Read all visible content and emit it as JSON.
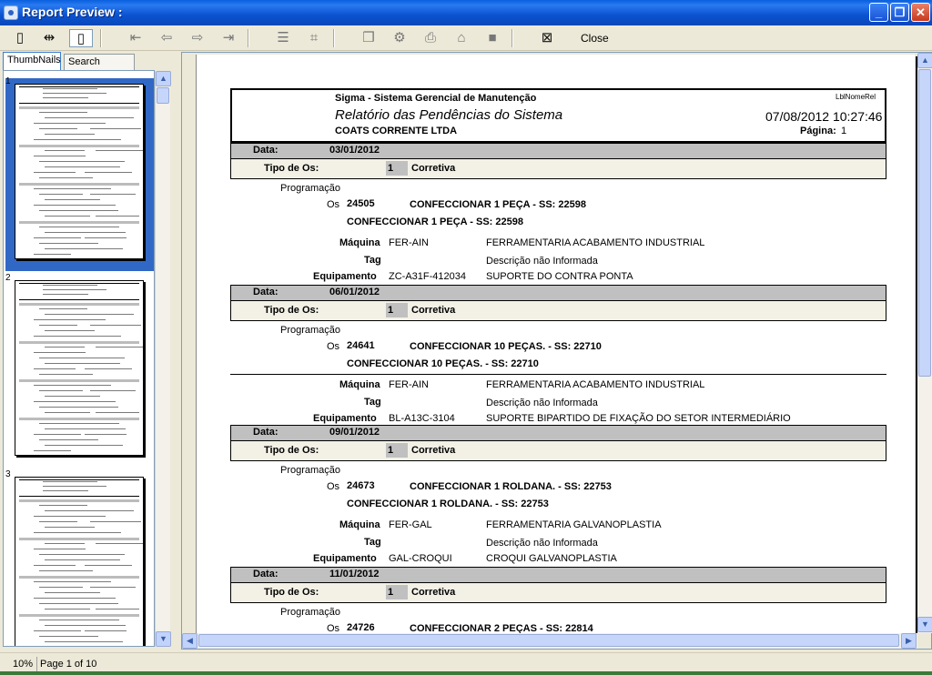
{
  "window": {
    "title": "Report Preview :"
  },
  "toolbar": {
    "close_label": "Close"
  },
  "left_panel": {
    "tabs": [
      "ThumbNails",
      "Search Results"
    ],
    "thumbnails": [
      {
        "number": "1",
        "selected": true
      },
      {
        "number": "2",
        "selected": false
      },
      {
        "number": "3",
        "selected": false
      }
    ]
  },
  "report": {
    "header": {
      "system_name": "Sigma - Sistema Gerencial de Manutenção",
      "title": "Relatório das Pendências do Sistema",
      "company": "COATS CORRENTE LTDA",
      "lbl_nome": "LblNomeRel",
      "datetime": "07/08/2012 10:27:46",
      "page_label": "Página:",
      "page_value": "1"
    },
    "labels": {
      "data": "Data:",
      "tipo_os": "Tipo de Os:",
      "programacao": "Programação",
      "os": "Os",
      "maquina": "Máquina",
      "tag": "Tag",
      "equipamento": "Equipamento"
    },
    "groups": [
      {
        "date": "03/01/2012",
        "tipo_code": "1",
        "tipo_name": "Corretiva",
        "os_number": "24505",
        "os_title": "CONFECCIONAR 1 PEÇA - SS: 22598",
        "os_desc": "CONFECCIONAR 1 PEÇA - SS: 22598",
        "maquina_code": "FER-AIN",
        "maquina_name": "FERRAMENTARIA ACABAMENTO INDUSTRIAL",
        "tag_value": "Descrição não Informada",
        "equip_code": "ZC-A31F-412034",
        "equip_name": "SUPORTE DO CONTRA PONTA"
      },
      {
        "date": "06/01/2012",
        "tipo_code": "1",
        "tipo_name": "Corretiva",
        "os_number": "24641",
        "os_title": "CONFECCIONAR 10 PEÇAS. - SS: 22710",
        "os_desc": "CONFECCIONAR 10 PEÇAS. - SS: 22710",
        "maquina_code": "FER-AIN",
        "maquina_name": "FERRAMENTARIA ACABAMENTO INDUSTRIAL",
        "tag_value": "Descrição não Informada",
        "equip_code": "BL-A13C-3104",
        "equip_name": "SUPORTE BIPARTIDO DE FIXAÇÃO DO SETOR INTERMEDIÁRIO"
      },
      {
        "date": "09/01/2012",
        "tipo_code": "1",
        "tipo_name": "Corretiva",
        "os_number": "24673",
        "os_title": "CONFECCIONAR 1 ROLDANA. - SS: 22753",
        "os_desc": "CONFECCIONAR 1 ROLDANA. - SS: 22753",
        "maquina_code": "FER-GAL",
        "maquina_name": "FERRAMENTARIA GALVANOPLASTIA",
        "tag_value": "Descrição não Informada",
        "equip_code": "GAL-CROQUI",
        "equip_name": "CROQUI GALVANOPLASTIA"
      },
      {
        "date": "11/01/2012",
        "tipo_code": "1",
        "tipo_name": "Corretiva",
        "os_number": "24726",
        "os_title": "CONFECCIONAR 2 PEÇAS - SS: 22814"
      }
    ]
  },
  "status": {
    "zoom": "10%",
    "page_info": "Page 1 of 10"
  }
}
